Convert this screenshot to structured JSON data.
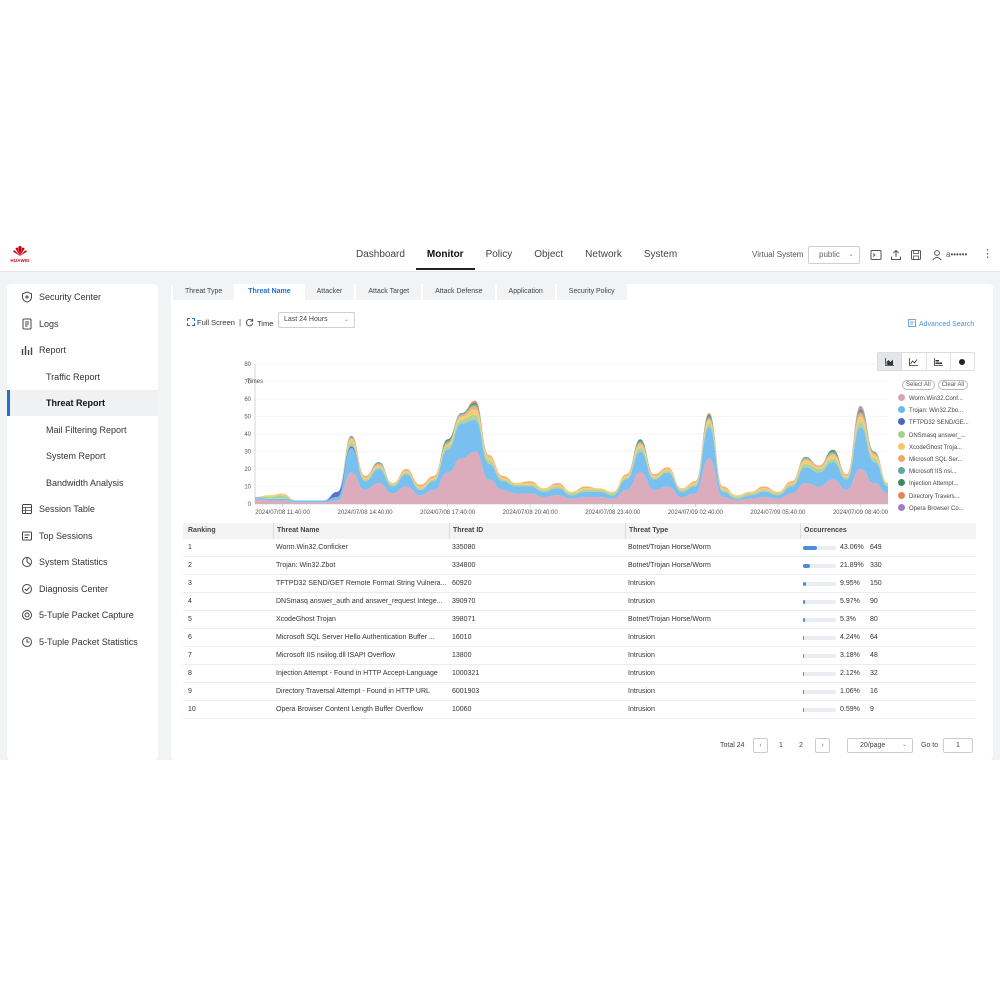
{
  "brand": {
    "name": "HUAWEI",
    "color": "#c7000b"
  },
  "topnav": {
    "items": [
      "Dashboard",
      "Monitor",
      "Policy",
      "Object",
      "Network",
      "System"
    ],
    "active": "Monitor",
    "virtual_system_label": "Virtual System",
    "virtual_system_value": "public",
    "user": "a••••••",
    "icons": [
      "terminal-icon",
      "upload-icon",
      "save-icon",
      "user-icon",
      "more-icon"
    ]
  },
  "sidebar": {
    "items": [
      {
        "label": "Security Center",
        "icon": "shield-icon",
        "level": 0
      },
      {
        "label": "Logs",
        "icon": "logs-icon",
        "level": 0
      },
      {
        "label": "Report",
        "icon": "report-icon",
        "level": 0
      },
      {
        "label": "Traffic Report",
        "level": 1
      },
      {
        "label": "Threat Report",
        "level": 1,
        "selected": true
      },
      {
        "label": "Mail Filtering Report",
        "level": 1
      },
      {
        "label": "System Report",
        "level": 1
      },
      {
        "label": "Bandwidth Analysis",
        "level": 1
      },
      {
        "label": "Session Table",
        "icon": "table-icon",
        "level": 0
      },
      {
        "label": "Top Sessions",
        "icon": "top-sessions-icon",
        "level": 0
      },
      {
        "label": "System Statistics",
        "icon": "statistics-icon",
        "level": 0
      },
      {
        "label": "Diagnosis Center",
        "icon": "diagnosis-icon",
        "level": 0
      },
      {
        "label": "5-Tuple Packet Capture",
        "icon": "capture-icon",
        "level": 0
      },
      {
        "label": "5-Tuple Packet Statistics",
        "icon": "packet-stats-icon",
        "level": 0
      }
    ]
  },
  "tabs": {
    "items": [
      "Threat Type",
      "Threat Name",
      "Attacker",
      "Attack Target",
      "Attack Defense",
      "Application",
      "Security Policy"
    ],
    "active": "Threat Name"
  },
  "toolbar": {
    "full_screen": "Full Screen",
    "separator": "|",
    "time_label": "Time",
    "time_value": "Last 24 Hours",
    "advanced_search": "Advanced Search"
  },
  "chart_types": [
    "area-chart-icon",
    "line-chart-icon",
    "bar-chart-icon",
    "pie-chart-icon"
  ],
  "legend": {
    "select_all": "Select All",
    "clear_all": "Clear All"
  },
  "chart_data": {
    "type": "area",
    "stacked": true,
    "ylabel": "Times",
    "ylim": [
      0,
      80
    ],
    "yticks": [
      0,
      10,
      20,
      30,
      40,
      50,
      60,
      70,
      80
    ],
    "xticks": [
      "2024/07/08 11:40:00",
      "2024/07/08 14:40:00",
      "2024/07/08 17:40:00",
      "2024/07/08 20:40:00",
      "2024/07/08 23:40:00",
      "2024/07/09 02:40:00",
      "2024/07/09 05:40:00",
      "2024/07/09 08:40:00"
    ],
    "x_hours": [
      0,
      0.5,
      1,
      1.5,
      2,
      2.5,
      3,
      3.5,
      4,
      4.5,
      5,
      5.5,
      6,
      6.5,
      7,
      7.5,
      8,
      8.5,
      9,
      9.5,
      10,
      10.5,
      11,
      11.5,
      12,
      12.5,
      13,
      13.5,
      14,
      14.5,
      15,
      15.5,
      16,
      16.5,
      17,
      17.5,
      18,
      18.5,
      19,
      19.5,
      20,
      20.5,
      21,
      21.5,
      22,
      22.5,
      23
    ],
    "series": [
      {
        "name": "Worm.Win32.Conf...",
        "color": "#d9a3b5",
        "values": [
          3,
          2,
          2,
          1,
          1,
          1,
          2,
          18,
          8,
          12,
          6,
          10,
          5,
          8,
          18,
          26,
          30,
          14,
          8,
          6,
          6,
          4,
          5,
          3,
          4,
          4,
          3,
          8,
          18,
          8,
          10,
          4,
          6,
          26,
          4,
          2,
          3,
          4,
          3,
          6,
          12,
          10,
          14,
          8,
          20,
          12,
          6
        ]
      },
      {
        "name": "Trojan: Win32.Zbo...",
        "color": "#6ab8ee",
        "values": [
          1,
          1,
          1,
          1,
          1,
          1,
          2,
          14,
          5,
          8,
          4,
          7,
          3,
          5,
          13,
          20,
          18,
          9,
          5,
          4,
          4,
          3,
          4,
          2,
          3,
          3,
          2,
          6,
          12,
          6,
          8,
          3,
          4,
          18,
          3,
          1,
          2,
          3,
          2,
          4,
          9,
          8,
          10,
          6,
          24,
          12,
          4
        ]
      },
      {
        "name": "TFTPD32 SEND/GE...",
        "color": "#4a66c4",
        "values": [
          0,
          0,
          0,
          0,
          0,
          0,
          3,
          1,
          0,
          0,
          0,
          0,
          0,
          0,
          0,
          0,
          0,
          0,
          0,
          0,
          0,
          0,
          0,
          0,
          0,
          0,
          0,
          0,
          0,
          0,
          0,
          0,
          0,
          0,
          0,
          0,
          0,
          0,
          0,
          0,
          0,
          0,
          0,
          0,
          0,
          0,
          0
        ]
      },
      {
        "name": "DNSmasq answer_...",
        "color": "#a8d08d",
        "values": [
          0,
          1,
          2,
          0,
          0,
          0,
          0,
          2,
          1,
          1,
          1,
          1,
          1,
          1,
          2,
          2,
          3,
          2,
          1,
          1,
          1,
          1,
          1,
          1,
          1,
          1,
          1,
          1,
          2,
          1,
          1,
          1,
          1,
          2,
          1,
          1,
          1,
          1,
          1,
          1,
          2,
          2,
          2,
          1,
          3,
          2,
          1
        ]
      },
      {
        "name": "XcodeGhost Troja...",
        "color": "#f2c86b",
        "values": [
          0,
          1,
          1,
          0,
          0,
          0,
          0,
          2,
          1,
          1,
          1,
          1,
          1,
          1,
          1,
          2,
          3,
          2,
          1,
          1,
          1,
          1,
          1,
          1,
          1,
          1,
          1,
          1,
          2,
          1,
          1,
          1,
          1,
          2,
          1,
          1,
          1,
          1,
          1,
          1,
          2,
          1,
          2,
          1,
          3,
          2,
          1
        ]
      },
      {
        "name": "Microsoft SQL Ser...",
        "color": "#f3a46b",
        "values": [
          0,
          0,
          0,
          0,
          0,
          0,
          0,
          1,
          1,
          1,
          0,
          1,
          1,
          1,
          1,
          1,
          2,
          1,
          1,
          0,
          1,
          0,
          1,
          0,
          1,
          0,
          0,
          1,
          1,
          1,
          1,
          0,
          1,
          1,
          1,
          0,
          0,
          1,
          0,
          1,
          1,
          1,
          1,
          1,
          2,
          1,
          0
        ]
      },
      {
        "name": "Microsoft IIS nsi...",
        "color": "#5fa5a0",
        "values": [
          0,
          0,
          0,
          0,
          0,
          0,
          0,
          1,
          0,
          1,
          0,
          0,
          0,
          0,
          1,
          1,
          1,
          0,
          0,
          0,
          0,
          0,
          0,
          0,
          0,
          0,
          0,
          0,
          1,
          0,
          0,
          0,
          0,
          1,
          0,
          0,
          0,
          0,
          0,
          0,
          1,
          0,
          1,
          0,
          1,
          1,
          0
        ]
      },
      {
        "name": "Injection Attempt...",
        "color": "#3a8a5a",
        "values": [
          0,
          0,
          0,
          0,
          0,
          0,
          0,
          0,
          0,
          0,
          0,
          0,
          0,
          0,
          1,
          0,
          1,
          0,
          0,
          0,
          0,
          0,
          0,
          0,
          0,
          0,
          0,
          0,
          1,
          0,
          0,
          0,
          0,
          1,
          0,
          0,
          0,
          0,
          0,
          0,
          0,
          0,
          1,
          0,
          1,
          0,
          0
        ]
      },
      {
        "name": "Directory Travers...",
        "color": "#e9845a",
        "values": [
          0,
          0,
          0,
          0,
          0,
          0,
          0,
          0,
          0,
          0,
          0,
          0,
          0,
          0,
          0,
          0,
          1,
          0,
          0,
          0,
          0,
          0,
          0,
          0,
          0,
          0,
          0,
          0,
          0,
          0,
          0,
          0,
          0,
          1,
          0,
          0,
          0,
          0,
          0,
          0,
          0,
          0,
          0,
          0,
          1,
          0,
          0
        ]
      },
      {
        "name": "Opera Browser Co...",
        "color": "#a27bc9",
        "values": [
          0,
          0,
          0,
          0,
          0,
          0,
          0,
          0,
          0,
          0,
          0,
          0,
          0,
          0,
          0,
          0,
          0,
          0,
          0,
          0,
          0,
          0,
          0,
          0,
          0,
          0,
          0,
          0,
          0,
          0,
          0,
          0,
          0,
          0,
          0,
          0,
          0,
          0,
          0,
          0,
          0,
          0,
          0,
          0,
          1,
          0,
          0
        ]
      }
    ]
  },
  "table": {
    "columns": [
      "Ranking",
      "Threat Name",
      "Threat ID",
      "Threat Type",
      "Occurrences"
    ],
    "rows": [
      {
        "rank": "1",
        "name": "Worm.Win32.Conficker",
        "id": "335080",
        "type": "Botnet/Trojan Horse/Worm",
        "pct": "43.06%",
        "share": 0.4306,
        "count": "649"
      },
      {
        "rank": "2",
        "name": "Trojan: Win32.Zbot",
        "id": "334800",
        "type": "Botnet/Trojan Horse/Worm",
        "pct": "21.89%",
        "share": 0.2189,
        "count": "330"
      },
      {
        "rank": "3",
        "name": "TFTPD32 SEND/GET Remote Format String Vulnera...",
        "id": "60920",
        "type": "Intrusion",
        "pct": "9.95%",
        "share": 0.0995,
        "count": "150"
      },
      {
        "rank": "4",
        "name": "DNSmasq answer_auth and answer_request Intege...",
        "id": "390970",
        "type": "Intrusion",
        "pct": "5.97%",
        "share": 0.0597,
        "count": "90"
      },
      {
        "rank": "5",
        "name": "XcodeGhost Trojan",
        "id": "398071",
        "type": "Botnet/Trojan Horse/Worm",
        "pct": "5.3%",
        "share": 0.053,
        "count": "80"
      },
      {
        "rank": "6",
        "name": "Microsoft SQL Server Hello Authentication Buffer ...",
        "id": "16010",
        "type": "Intrusion",
        "pct": "4.24%",
        "share": 0.0424,
        "count": "64"
      },
      {
        "rank": "7",
        "name": "Microsoft IIS nsiilog.dll ISAPI Overflow",
        "id": "13800",
        "type": "Intrusion",
        "pct": "3.18%",
        "share": 0.0318,
        "count": "48"
      },
      {
        "rank": "8",
        "name": "Injection Attempt - Found in HTTP Accept-Language",
        "id": "1000321",
        "type": "Intrusion",
        "pct": "2.12%",
        "share": 0.0212,
        "count": "32"
      },
      {
        "rank": "9",
        "name": "Directory Traversal Attempt -  Found in HTTP URL",
        "id": "6001903",
        "type": "Intrusion",
        "pct": "1.06%",
        "share": 0.0106,
        "count": "16"
      },
      {
        "rank": "10",
        "name": "Opera Browser Content Length Buffer Overflow",
        "id": "10060",
        "type": "Intrusion",
        "pct": "0.59%",
        "share": 0.0059,
        "count": "9"
      }
    ]
  },
  "pagination": {
    "total": "Total 24",
    "prev": "‹",
    "pages": [
      "1",
      "2"
    ],
    "next": "›",
    "per_page": "20/page",
    "goto_label": "Go to",
    "goto_value": "1"
  }
}
